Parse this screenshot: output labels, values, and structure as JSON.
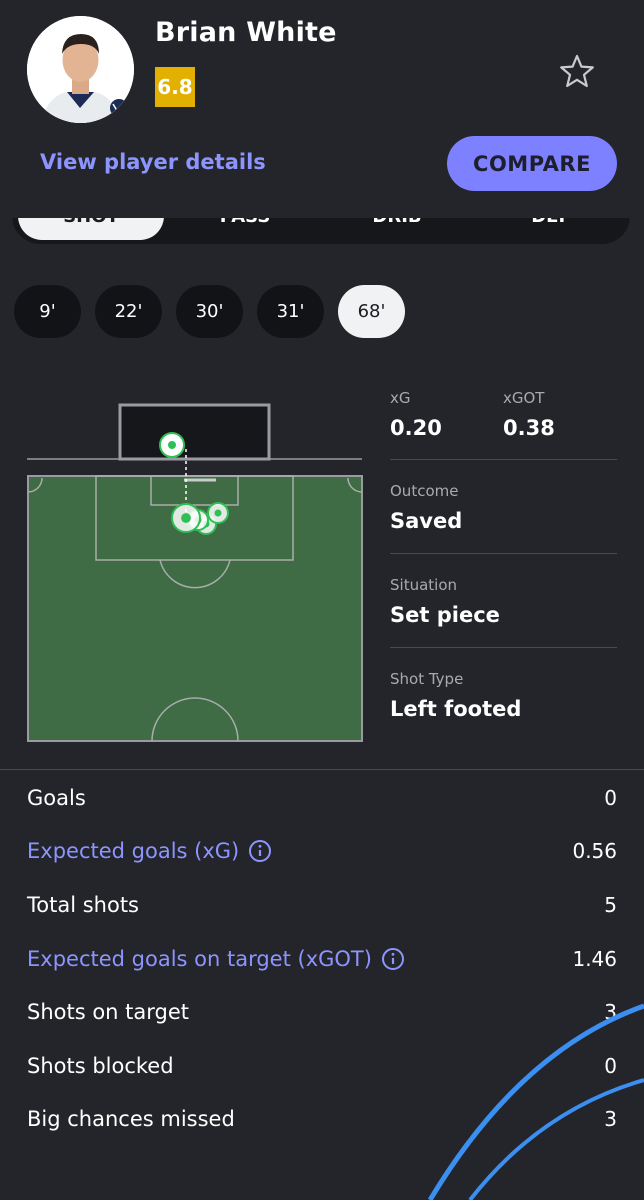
{
  "player": {
    "name": "Brian White",
    "rating": "6.8"
  },
  "header": {
    "details_link": "View player details",
    "compare_label": "COMPARE"
  },
  "tabs": [
    {
      "label": "SHOT",
      "active": true
    },
    {
      "label": "PASS",
      "active": false
    },
    {
      "label": "DRIB",
      "active": false
    },
    {
      "label": "DEF",
      "active": false
    }
  ],
  "minutes": [
    {
      "label": "9'",
      "active": false
    },
    {
      "label": "22'",
      "active": false
    },
    {
      "label": "30'",
      "active": false
    },
    {
      "label": "31'",
      "active": false
    },
    {
      "label": "68'",
      "active": true
    }
  ],
  "shot_detail": {
    "xg_label": "xG",
    "xg_value": "0.20",
    "xgot_label": "xGOT",
    "xgot_value": "0.38",
    "outcome_label": "Outcome",
    "outcome_value": "Saved",
    "situation_label": "Situation",
    "situation_value": "Set piece",
    "shot_type_label": "Shot Type",
    "shot_type_value": "Left footed"
  },
  "stats": [
    {
      "label": "Goals",
      "value": "0",
      "highlight": false,
      "info": false
    },
    {
      "label": "Expected goals (xG)",
      "value": "0.56",
      "highlight": true,
      "info": true
    },
    {
      "label": "Total shots",
      "value": "5",
      "highlight": false,
      "info": false
    },
    {
      "label": "Expected goals on target (xGOT)",
      "value": "1.46",
      "highlight": true,
      "info": true
    },
    {
      "label": "Shots on target",
      "value": "3",
      "highlight": false,
      "info": false
    },
    {
      "label": "Shots blocked",
      "value": "0",
      "highlight": false,
      "info": false
    },
    {
      "label": "Big chances missed",
      "value": "3",
      "highlight": false,
      "info": false
    }
  ],
  "colors": {
    "background": "#24252a",
    "accent": "#7d80ff",
    "link": "#8c95ff",
    "rating": "#e1b000",
    "pitch": "#3f6b45",
    "shot_marker": "#2fbf55"
  },
  "icons": {
    "favorite": "star-outline-icon",
    "info": "info-circle-icon"
  }
}
